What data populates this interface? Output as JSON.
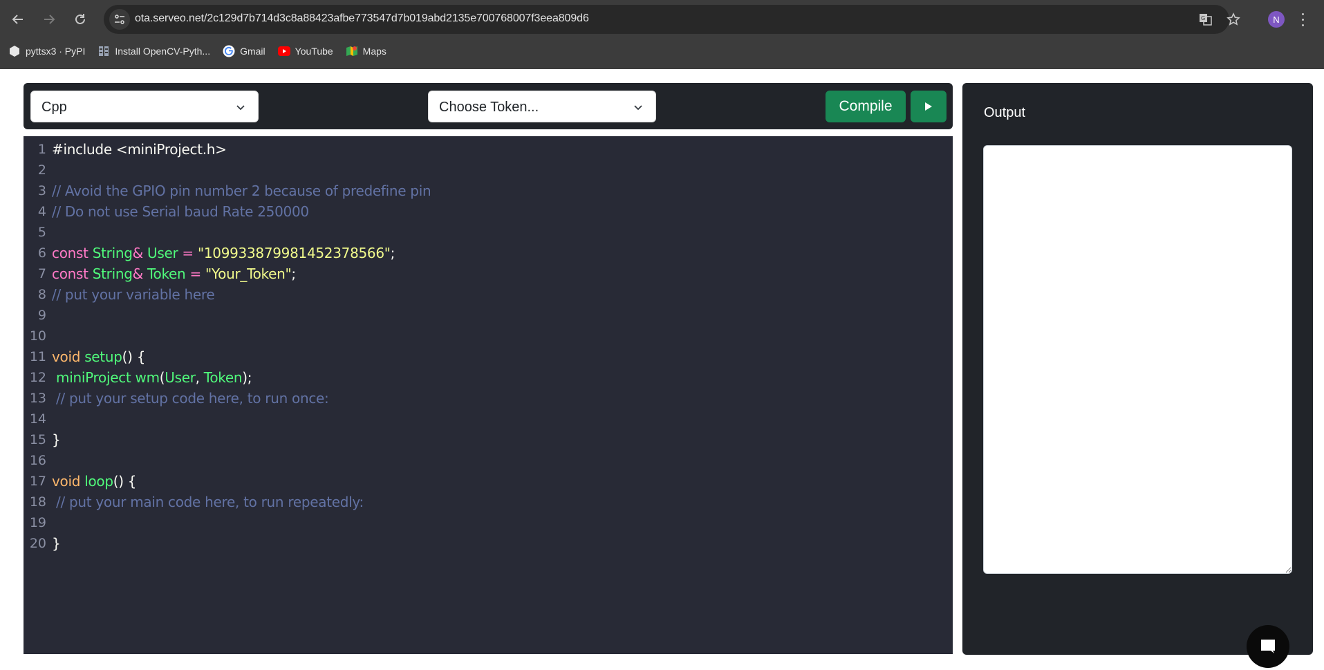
{
  "browser": {
    "url": "ota.serveo.net/2c129d7b714d3c8a88423afbe773547d7b019abd2135e700768007f3eea809d6",
    "profile_initial": "N",
    "bookmarks": [
      {
        "label": "pyttsx3 · PyPI",
        "icon": "pypi-icon"
      },
      {
        "label": "Install OpenCV-Pyth...",
        "icon": "opencv-doc-icon"
      },
      {
        "label": "Gmail",
        "icon": "google-icon"
      },
      {
        "label": "YouTube",
        "icon": "youtube-icon"
      },
      {
        "label": "Maps",
        "icon": "maps-icon"
      }
    ]
  },
  "toolbar": {
    "language_select": "Cpp",
    "token_select": "Choose Token...",
    "compile_label": "Compile",
    "run_icon": "play-icon"
  },
  "editor": {
    "lines": [
      {
        "n": "1",
        "tokens": [
          {
            "t": "#include <miniProject.h>",
            "c": "plain"
          }
        ]
      },
      {
        "n": "2",
        "tokens": []
      },
      {
        "n": "3",
        "tokens": [
          {
            "t": "// Avoid the GPIO pin number 2 because of predefine pin",
            "c": "comment"
          }
        ]
      },
      {
        "n": "4",
        "tokens": [
          {
            "t": "// Do not use Serial baud Rate 250000",
            "c": "comment"
          }
        ]
      },
      {
        "n": "5",
        "tokens": []
      },
      {
        "n": "6",
        "tokens": [
          {
            "t": "const ",
            "c": "keyword"
          },
          {
            "t": "String",
            "c": "type"
          },
          {
            "t": "& ",
            "c": "keyword"
          },
          {
            "t": "User",
            "c": "type"
          },
          {
            "t": " = ",
            "c": "keyword"
          },
          {
            "t": "\"109933879981452378566\"",
            "c": "string"
          },
          {
            "t": ";",
            "c": "plain"
          }
        ]
      },
      {
        "n": "7",
        "tokens": [
          {
            "t": "const ",
            "c": "keyword"
          },
          {
            "t": "String",
            "c": "type"
          },
          {
            "t": "& ",
            "c": "keyword"
          },
          {
            "t": "Token",
            "c": "type"
          },
          {
            "t": " = ",
            "c": "keyword"
          },
          {
            "t": "\"Your_Token\"",
            "c": "string"
          },
          {
            "t": ";",
            "c": "plain"
          }
        ]
      },
      {
        "n": "8",
        "tokens": [
          {
            "t": "// put your variable here",
            "c": "comment"
          }
        ]
      },
      {
        "n": "9",
        "tokens": []
      },
      {
        "n": "10",
        "tokens": []
      },
      {
        "n": "11",
        "tokens": [
          {
            "t": "void ",
            "c": "void"
          },
          {
            "t": "setup",
            "c": "fn"
          },
          {
            "t": "() {",
            "c": "plain"
          }
        ]
      },
      {
        "n": "12",
        "tokens": [
          {
            "t": " miniProject wm",
            "c": "fn"
          },
          {
            "t": "(",
            "c": "plain"
          },
          {
            "t": "User",
            "c": "type"
          },
          {
            "t": ", ",
            "c": "plain"
          },
          {
            "t": "Token",
            "c": "type"
          },
          {
            "t": ");",
            "c": "plain"
          }
        ]
      },
      {
        "n": "13",
        "tokens": [
          {
            "t": " // put your setup code here, to run once:",
            "c": "comment"
          }
        ]
      },
      {
        "n": "14",
        "tokens": []
      },
      {
        "n": "15",
        "tokens": [
          {
            "t": "}",
            "c": "plain"
          }
        ]
      },
      {
        "n": "16",
        "tokens": []
      },
      {
        "n": "17",
        "tokens": [
          {
            "t": "void ",
            "c": "void"
          },
          {
            "t": "loop",
            "c": "fn"
          },
          {
            "t": "() {",
            "c": "plain"
          }
        ]
      },
      {
        "n": "18",
        "tokens": [
          {
            "t": " // put your main code here, to run repeatedly:",
            "c": "comment"
          }
        ]
      },
      {
        "n": "19",
        "tokens": []
      },
      {
        "n": "20",
        "tokens": [
          {
            "t": "}",
            "c": "plain"
          }
        ]
      }
    ]
  },
  "output": {
    "title": "Output",
    "value": ""
  },
  "colors": {
    "accent_green": "#198754",
    "editor_bg": "#282a36",
    "panel_bg": "#212429"
  }
}
